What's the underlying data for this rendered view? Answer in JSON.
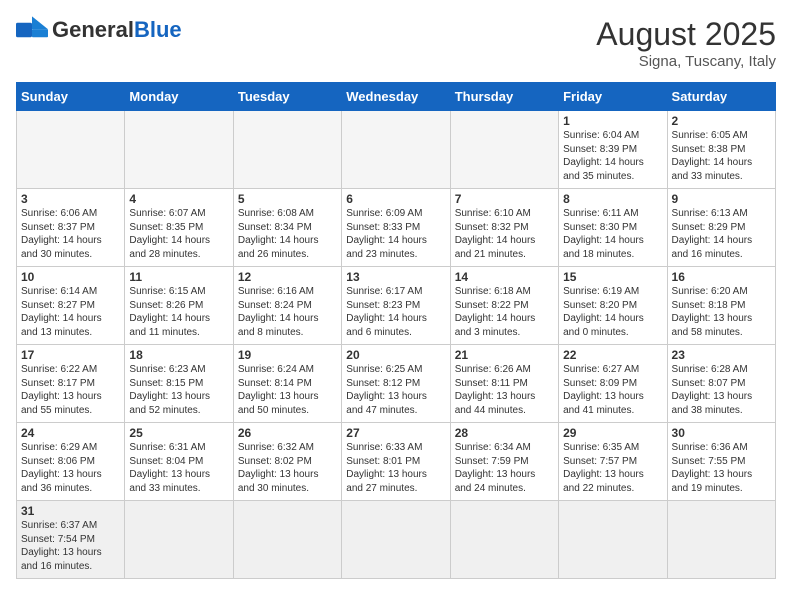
{
  "header": {
    "logo_general": "General",
    "logo_blue": "Blue",
    "month_year": "August 2025",
    "location": "Signa, Tuscany, Italy"
  },
  "days_of_week": [
    "Sunday",
    "Monday",
    "Tuesday",
    "Wednesday",
    "Thursday",
    "Friday",
    "Saturday"
  ],
  "weeks": [
    [
      {
        "day": "",
        "info": ""
      },
      {
        "day": "",
        "info": ""
      },
      {
        "day": "",
        "info": ""
      },
      {
        "day": "",
        "info": ""
      },
      {
        "day": "",
        "info": ""
      },
      {
        "day": "1",
        "info": "Sunrise: 6:04 AM\nSunset: 8:39 PM\nDaylight: 14 hours and 35 minutes."
      },
      {
        "day": "2",
        "info": "Sunrise: 6:05 AM\nSunset: 8:38 PM\nDaylight: 14 hours and 33 minutes."
      }
    ],
    [
      {
        "day": "3",
        "info": "Sunrise: 6:06 AM\nSunset: 8:37 PM\nDaylight: 14 hours and 30 minutes."
      },
      {
        "day": "4",
        "info": "Sunrise: 6:07 AM\nSunset: 8:35 PM\nDaylight: 14 hours and 28 minutes."
      },
      {
        "day": "5",
        "info": "Sunrise: 6:08 AM\nSunset: 8:34 PM\nDaylight: 14 hours and 26 minutes."
      },
      {
        "day": "6",
        "info": "Sunrise: 6:09 AM\nSunset: 8:33 PM\nDaylight: 14 hours and 23 minutes."
      },
      {
        "day": "7",
        "info": "Sunrise: 6:10 AM\nSunset: 8:32 PM\nDaylight: 14 hours and 21 minutes."
      },
      {
        "day": "8",
        "info": "Sunrise: 6:11 AM\nSunset: 8:30 PM\nDaylight: 14 hours and 18 minutes."
      },
      {
        "day": "9",
        "info": "Sunrise: 6:13 AM\nSunset: 8:29 PM\nDaylight: 14 hours and 16 minutes."
      }
    ],
    [
      {
        "day": "10",
        "info": "Sunrise: 6:14 AM\nSunset: 8:27 PM\nDaylight: 14 hours and 13 minutes."
      },
      {
        "day": "11",
        "info": "Sunrise: 6:15 AM\nSunset: 8:26 PM\nDaylight: 14 hours and 11 minutes."
      },
      {
        "day": "12",
        "info": "Sunrise: 6:16 AM\nSunset: 8:24 PM\nDaylight: 14 hours and 8 minutes."
      },
      {
        "day": "13",
        "info": "Sunrise: 6:17 AM\nSunset: 8:23 PM\nDaylight: 14 hours and 6 minutes."
      },
      {
        "day": "14",
        "info": "Sunrise: 6:18 AM\nSunset: 8:22 PM\nDaylight: 14 hours and 3 minutes."
      },
      {
        "day": "15",
        "info": "Sunrise: 6:19 AM\nSunset: 8:20 PM\nDaylight: 14 hours and 0 minutes."
      },
      {
        "day": "16",
        "info": "Sunrise: 6:20 AM\nSunset: 8:18 PM\nDaylight: 13 hours and 58 minutes."
      }
    ],
    [
      {
        "day": "17",
        "info": "Sunrise: 6:22 AM\nSunset: 8:17 PM\nDaylight: 13 hours and 55 minutes."
      },
      {
        "day": "18",
        "info": "Sunrise: 6:23 AM\nSunset: 8:15 PM\nDaylight: 13 hours and 52 minutes."
      },
      {
        "day": "19",
        "info": "Sunrise: 6:24 AM\nSunset: 8:14 PM\nDaylight: 13 hours and 50 minutes."
      },
      {
        "day": "20",
        "info": "Sunrise: 6:25 AM\nSunset: 8:12 PM\nDaylight: 13 hours and 47 minutes."
      },
      {
        "day": "21",
        "info": "Sunrise: 6:26 AM\nSunset: 8:11 PM\nDaylight: 13 hours and 44 minutes."
      },
      {
        "day": "22",
        "info": "Sunrise: 6:27 AM\nSunset: 8:09 PM\nDaylight: 13 hours and 41 minutes."
      },
      {
        "day": "23",
        "info": "Sunrise: 6:28 AM\nSunset: 8:07 PM\nDaylight: 13 hours and 38 minutes."
      }
    ],
    [
      {
        "day": "24",
        "info": "Sunrise: 6:29 AM\nSunset: 8:06 PM\nDaylight: 13 hours and 36 minutes."
      },
      {
        "day": "25",
        "info": "Sunrise: 6:31 AM\nSunset: 8:04 PM\nDaylight: 13 hours and 33 minutes."
      },
      {
        "day": "26",
        "info": "Sunrise: 6:32 AM\nSunset: 8:02 PM\nDaylight: 13 hours and 30 minutes."
      },
      {
        "day": "27",
        "info": "Sunrise: 6:33 AM\nSunset: 8:01 PM\nDaylight: 13 hours and 27 minutes."
      },
      {
        "day": "28",
        "info": "Sunrise: 6:34 AM\nSunset: 7:59 PM\nDaylight: 13 hours and 24 minutes."
      },
      {
        "day": "29",
        "info": "Sunrise: 6:35 AM\nSunset: 7:57 PM\nDaylight: 13 hours and 22 minutes."
      },
      {
        "day": "30",
        "info": "Sunrise: 6:36 AM\nSunset: 7:55 PM\nDaylight: 13 hours and 19 minutes."
      }
    ],
    [
      {
        "day": "31",
        "info": "Sunrise: 6:37 AM\nSunset: 7:54 PM\nDaylight: 13 hours and 16 minutes."
      },
      {
        "day": "",
        "info": ""
      },
      {
        "day": "",
        "info": ""
      },
      {
        "day": "",
        "info": ""
      },
      {
        "day": "",
        "info": ""
      },
      {
        "day": "",
        "info": ""
      },
      {
        "day": "",
        "info": ""
      }
    ]
  ]
}
